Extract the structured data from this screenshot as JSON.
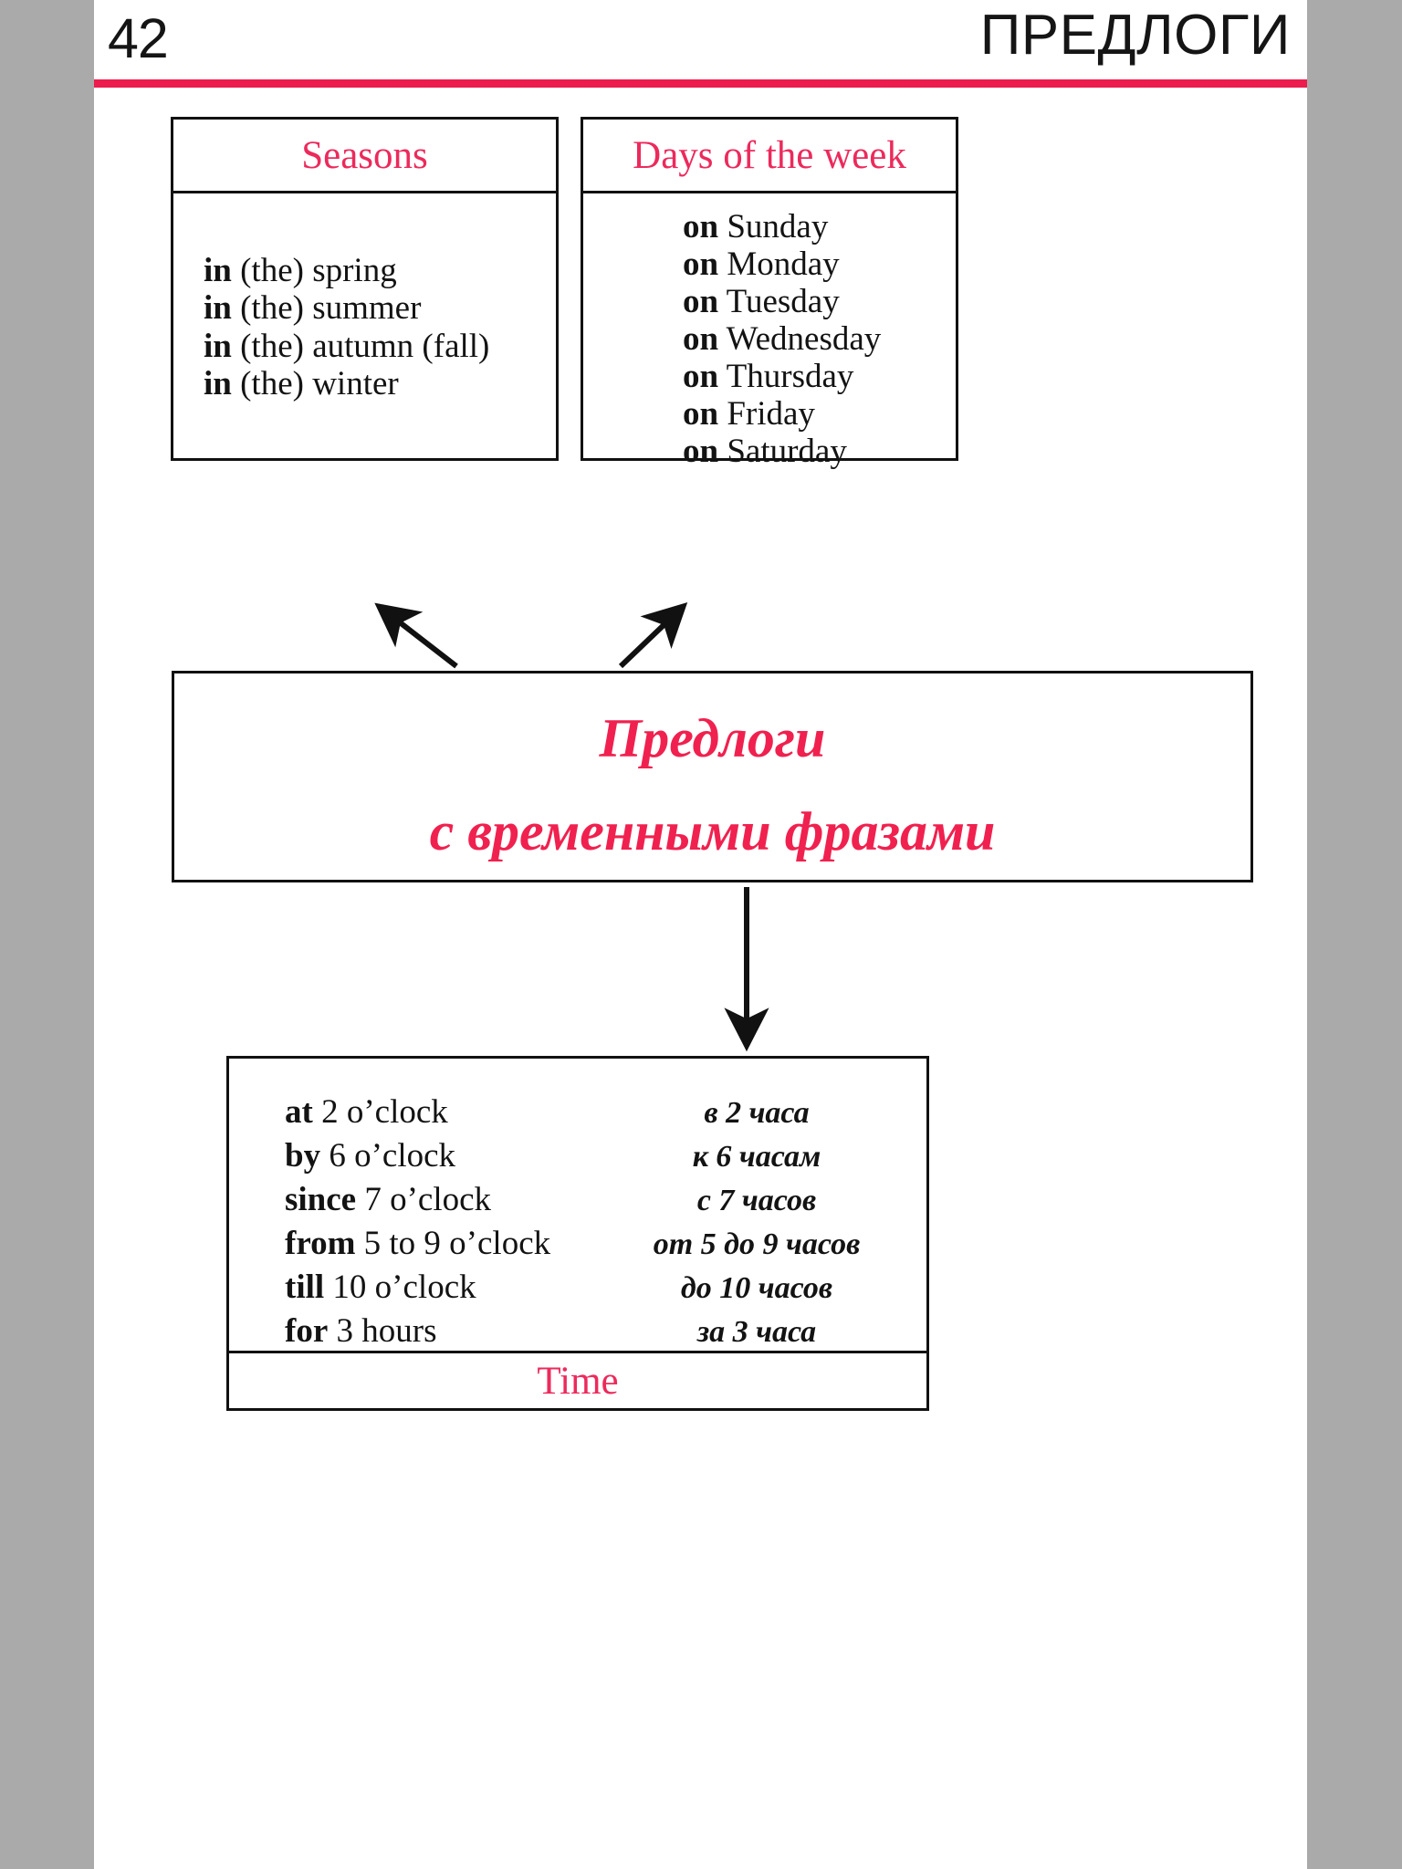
{
  "header": {
    "page_number": "42",
    "title": "ПРЕДЛОГИ",
    "rule_color": "#ec1c4e"
  },
  "colors": {
    "accent_pink": "#ec2a5c",
    "title_pink": "#f0214f",
    "ink": "#131313",
    "gutter_gray": "#aaaaaa"
  },
  "seasons": {
    "title": "Seasons",
    "items": [
      {
        "prep": "in",
        "rest": " (the) spring"
      },
      {
        "prep": "in",
        "rest": " (the) summer"
      },
      {
        "prep": "in",
        "rest": " (the) autumn (fall)"
      },
      {
        "prep": "in",
        "rest": " (the) winter"
      }
    ]
  },
  "days": {
    "title": "Days of the week",
    "items": [
      {
        "prep": "on",
        "rest": " Sunday"
      },
      {
        "prep": "on",
        "rest": " Monday"
      },
      {
        "prep": "on",
        "rest": " Tuesday"
      },
      {
        "prep": "on",
        "rest": " Wednesday"
      },
      {
        "prep": "on",
        "rest": " Thursday"
      },
      {
        "prep": "on",
        "rest": " Friday"
      },
      {
        "prep": "on",
        "rest": " Saturday"
      }
    ]
  },
  "center": {
    "line1": "Предлоги",
    "line2": "с временными фразами"
  },
  "time": {
    "footer_title": "Time",
    "rows": [
      {
        "prep": "at",
        "rest": " 2 o’clock",
        "ru": "в 2 часа"
      },
      {
        "prep": "by",
        "rest": " 6 o’clock",
        "ru": "к 6 часам"
      },
      {
        "prep": "since",
        "rest": " 7 o’clock",
        "ru": "с 7 часов"
      },
      {
        "prep": "from",
        "rest": " 5 to 9 o’clock",
        "ru": "от 5 до 9 часов"
      },
      {
        "prep": "till",
        "rest": " 10 o’clock",
        "ru": "до 10 часов"
      },
      {
        "prep": "for",
        "rest": " 3 hours",
        "ru": "за 3 часа"
      }
    ]
  }
}
